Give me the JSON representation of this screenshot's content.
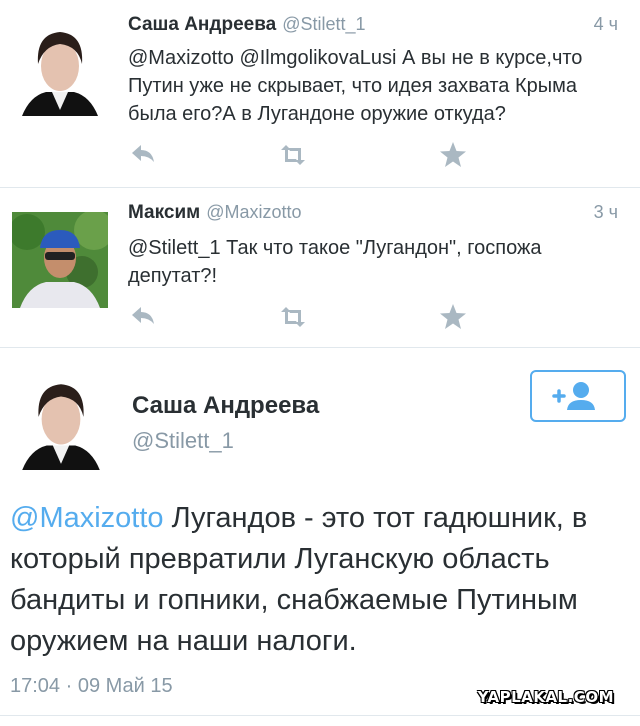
{
  "tweets": [
    {
      "name": "Саша Андреева",
      "handle": "@Stilett_1",
      "time": "4 ч",
      "text_lines": [
        "@Maxizotto @IlmgolikovaLusi А вы не в  курсе,что",
        "Путин уже не скрывает, что идея захвата Крыма",
        "была его?А в Лугандоне оружие откуда?"
      ]
    },
    {
      "name": "Максим",
      "handle": "@Maxizotto",
      "time": "3 ч",
      "text_lines": [
        "@Stilett_1 Так что такое \"Лугандон\", госпожа",
        "депутат?!"
      ]
    }
  ],
  "detail": {
    "name": "Саша Андреева",
    "handle": "@Stilett_1",
    "mention": "@Maxizotto",
    "text_rest": " Лугандов - это тот гадюшник, в который превратили Луганскую область бандиты и гопники, снабжаемые Путиным оружием на наши налоги.",
    "time": "17:04 · 09 Май 15"
  },
  "watermark": "YAPLAKAL.COM",
  "icons": [
    "reply-icon",
    "retweet-icon",
    "favorite-icon",
    "add-user-icon"
  ],
  "colors": {
    "accent": "#55acee",
    "muted": "#8899a6",
    "icon": "#aab8c2",
    "text": "#292f33"
  }
}
